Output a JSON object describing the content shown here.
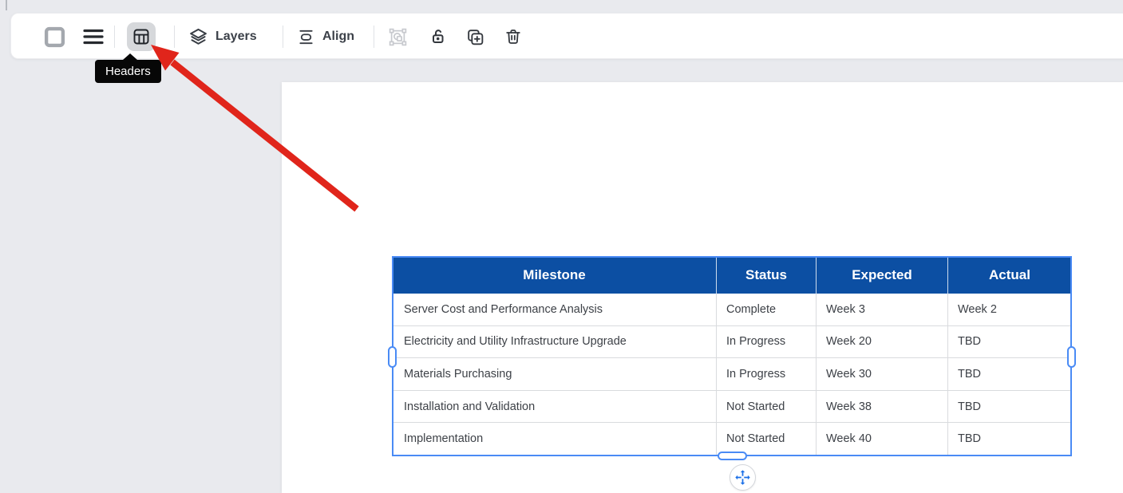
{
  "toolbar": {
    "border_button": {
      "icon": "square-outline-icon"
    },
    "menu_button": {
      "icon": "hamburger-icon"
    },
    "headers_button": {
      "icon": "table-headers-icon",
      "selected": true
    },
    "layers": {
      "label": "Layers",
      "icon": "layers-icon"
    },
    "align": {
      "label": "Align",
      "icon": "align-middle-icon"
    },
    "mask_button": {
      "icon": "crop-mask-icon",
      "disabled": true
    },
    "lock_button": {
      "icon": "unlock-icon"
    },
    "duplicate_button": {
      "icon": "duplicate-plus-icon"
    },
    "delete_button": {
      "icon": "trash-icon"
    }
  },
  "tooltip": {
    "text": "Headers"
  },
  "canvas": {
    "table": {
      "headers": [
        "Milestone",
        "Status",
        "Expected",
        "Actual"
      ],
      "rows": [
        [
          "Server Cost and Performance Analysis",
          "Complete",
          "Week 3",
          "Week 2"
        ],
        [
          "Electricity and Utility Infrastructure Upgrade",
          "In Progress",
          "Week 20",
          "TBD"
        ],
        [
          "Materials Purchasing",
          "In Progress",
          "Week 30",
          "TBD"
        ],
        [
          "Installation and Validation",
          "Not Started",
          "Week 38",
          "TBD"
        ],
        [
          "Implementation",
          "Not Started",
          "Week 40",
          "TBD"
        ]
      ]
    }
  },
  "annotation": {
    "type": "red-arrow",
    "points_to": "headers-button"
  },
  "colors": {
    "page_bg": "#e9eaee",
    "table_header_bg": "#0c4fa3",
    "table_header_text": "#ffffff",
    "selection_blue": "#4a8bf5",
    "arrow_red": "#e0251b",
    "tooltip_bg": "#070707",
    "selected_button_bg": "#d6d8db"
  }
}
